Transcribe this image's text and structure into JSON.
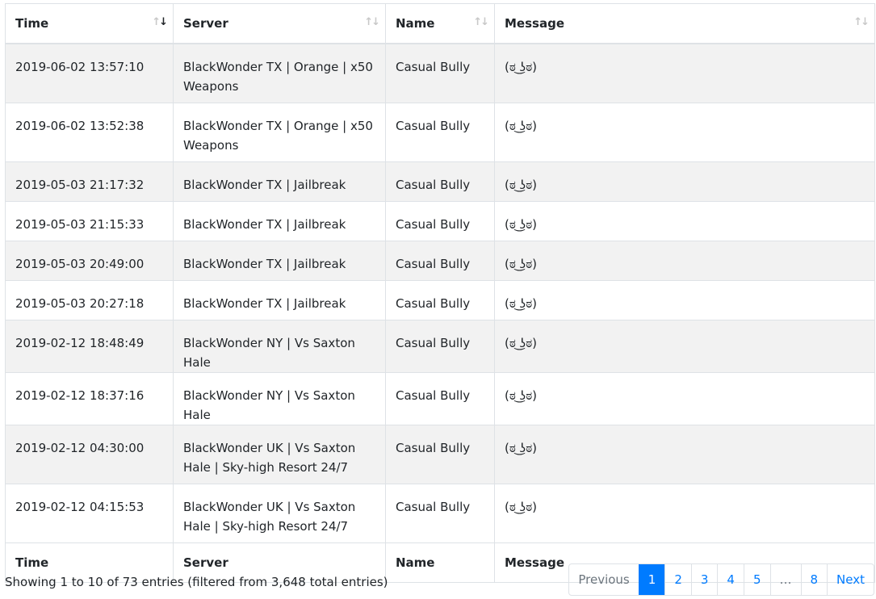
{
  "table": {
    "headers": [
      "Time",
      "Server",
      "Name",
      "Message"
    ],
    "rows": [
      {
        "time": "2019-06-02 13:57:10",
        "server": "BlackWonder TX | Orange | x50 Weapons",
        "name": "Casual Bully",
        "message": "(ಠ ͜ʖಠ)"
      },
      {
        "time": "2019-06-02 13:52:38",
        "server": "BlackWonder TX | Orange | x50 Weapons",
        "name": "Casual Bully",
        "message": "(ಠ ͜ʖಠ)"
      },
      {
        "time": "2019-05-03 21:17:32",
        "server": "BlackWonder TX | Jailbreak",
        "name": "Casual Bully",
        "message": "(ಠ ͜ʖಠ)"
      },
      {
        "time": "2019-05-03 21:15:33",
        "server": "BlackWonder TX | Jailbreak",
        "name": "Casual Bully",
        "message": "(ಠ ͜ʖಠ)"
      },
      {
        "time": "2019-05-03 20:49:00",
        "server": "BlackWonder TX | Jailbreak",
        "name": "Casual Bully",
        "message": "(ಠ ͜ʖಠ)"
      },
      {
        "time": "2019-05-03 20:27:18",
        "server": "BlackWonder TX | Jailbreak",
        "name": "Casual Bully",
        "message": "(ಠ ͜ʖಠ)"
      },
      {
        "time": "2019-02-12 18:48:49",
        "server": "BlackWonder NY | Vs Saxton Hale",
        "name": "Casual Bully",
        "message": "(ಠ ͜ʖಠ)"
      },
      {
        "time": "2019-02-12 18:37:16",
        "server": "BlackWonder NY | Vs Saxton Hale",
        "name": "Casual Bully",
        "message": "(ಠ ͜ʖಠ)"
      },
      {
        "time": "2019-02-12 04:30:00",
        "server": "BlackWonder UK | Vs Saxton Hale | Sky-high Resort 24/7",
        "name": "Casual Bully",
        "message": "(ಠ ͜ʖಠ)"
      },
      {
        "time": "2019-02-12 04:15:53",
        "server": "BlackWonder UK | Vs Saxton Hale | Sky-high Resort 24/7",
        "name": "Casual Bully",
        "message": "(ಠ ͜ʖಠ)"
      }
    ]
  },
  "sort_icon": {
    "up": "↑",
    "down": "↓",
    "name": "sort-arrows-icon"
  },
  "info": "Showing 1 to 10 of 73 entries (filtered from 3,648 total entries)",
  "pagination": {
    "previous": "Previous",
    "pages": [
      "1",
      "2",
      "3",
      "4",
      "5"
    ],
    "ellipsis": "…",
    "last": "8",
    "next": "Next",
    "current": "1"
  },
  "colors": {
    "accent": "#007bff",
    "stripe": "#f2f2f2",
    "border": "#dee2e6"
  }
}
